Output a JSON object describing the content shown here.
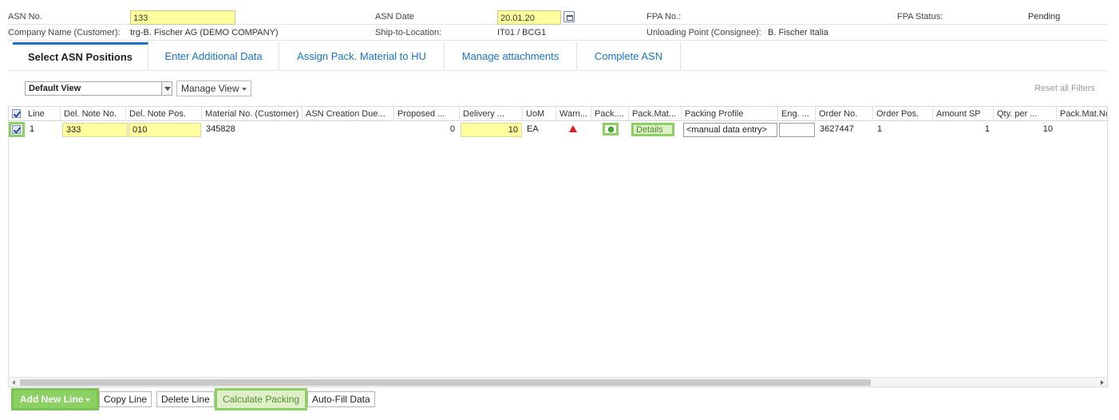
{
  "header": {
    "row1": {
      "asn_no_label": "ASN No.",
      "asn_no_value": "133",
      "asn_date_label": "ASN Date",
      "asn_date_value": "20.01.20",
      "fpa_no_label": "FPA No.:",
      "fpa_status_label": "FPA Status:",
      "fpa_status_value": "Pending"
    },
    "row2": {
      "company_label": "Company Name (Customer):",
      "company_value": "trg-B. Fischer AG (DEMO COMPANY)",
      "ship_to_label": "Ship-to-Location:",
      "ship_to_value": "IT01 / BCG1",
      "unloading_label": "Unloading Point (Consignee):",
      "unloading_value": "B. Fischer Italia"
    }
  },
  "tabs": [
    {
      "label": "Select ASN Positions",
      "active": true
    },
    {
      "label": "Enter Additional Data",
      "active": false
    },
    {
      "label": "Assign Pack. Material to HU",
      "active": false
    },
    {
      "label": "Manage attachments",
      "active": false
    },
    {
      "label": "Complete ASN",
      "active": false
    }
  ],
  "toolbar": {
    "view_value": "Default View",
    "manage_view_label": "Manage View",
    "reset_filters_label": "Reset all Filters"
  },
  "grid": {
    "columns": [
      "Line",
      "Del. Note No.",
      "Del. Note Pos.",
      "Material No. (Customer)",
      "ASN Creation Due...",
      "Proposed ...",
      "Delivery ...",
      "UoM",
      "Warn...",
      "Pack....",
      "Pack.Mat...",
      "Packing Profile",
      "Eng. ...",
      "Order No.",
      "Order Pos.",
      "Amount SP",
      "Qty. per ...",
      "Pack.Mat.No"
    ],
    "rows": [
      {
        "line": "1",
        "del_note_no": "333",
        "del_note_pos": "010",
        "material_no": "345828",
        "asn_creation_due": "",
        "proposed": "0",
        "delivery": "10",
        "uom": "EA",
        "details_label": "Details",
        "packing_profile": "<manual data entry>",
        "eng": "",
        "order_no": "3627447",
        "order_pos": "1",
        "amount_sp": "1",
        "qty_per": "10"
      }
    ],
    "status_colors": {
      "warning": "#e02020",
      "ok": "#4cae2e",
      "highlight": "#8ccf62",
      "editable": "#ffff9e"
    }
  },
  "bottom_bar": {
    "add_new_line_label": "Add New Line",
    "copy_line_label": "Copy Line",
    "delete_line_label": "Delete Line",
    "calculate_packing_label": "Calculate Packing",
    "auto_fill_label": "Auto-Fill Data"
  }
}
